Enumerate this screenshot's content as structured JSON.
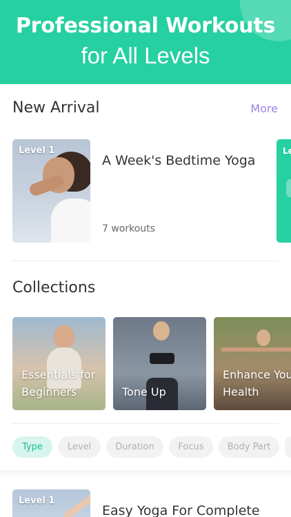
{
  "hero": {
    "line1": "Professional Workouts",
    "line2": "for All Levels"
  },
  "new_arrival": {
    "title": "New Arrival",
    "more": "More",
    "card": {
      "level": "Level 1",
      "title": "A Week's Bedtime Yoga",
      "subtitle": "7 workouts"
    },
    "peek_level": "Le"
  },
  "collections": {
    "title": "Collections",
    "items": [
      {
        "label": "Essentials for Beginners"
      },
      {
        "label": "Tone Up"
      },
      {
        "label": "Enhance Your Health"
      }
    ]
  },
  "filters": {
    "chips": [
      {
        "label": "Type",
        "active": true
      },
      {
        "label": "Level",
        "active": false
      },
      {
        "label": "Duration",
        "active": false
      },
      {
        "label": "Focus",
        "active": false
      },
      {
        "label": "Body Part",
        "active": false
      }
    ]
  },
  "bottom_card": {
    "level": "Level 1",
    "title": "Easy Yoga For Complete"
  },
  "colors": {
    "accent": "#26d0a0",
    "more_link": "#9a83e0",
    "chip_active_bg": "#d7f5ec",
    "chip_active_text": "#1fbe90"
  }
}
